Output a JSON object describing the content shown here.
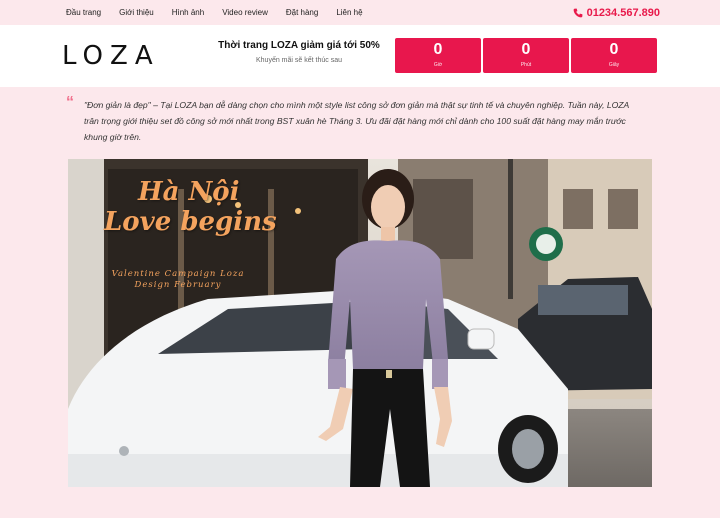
{
  "nav": {
    "items": [
      {
        "label": "Đầu trang"
      },
      {
        "label": "Giới thiệu"
      },
      {
        "label": "Hình ảnh"
      },
      {
        "label": "Video review"
      },
      {
        "label": "Đặt hàng"
      },
      {
        "label": "Liên hệ"
      }
    ],
    "phone": "01234.567.890"
  },
  "header": {
    "logo": "LOZA",
    "promo_title": "Thời trang LOZA giảm giá tới 50%",
    "promo_sub": "Khuyến mãi sẽ kết thúc sau",
    "countdown": [
      {
        "value": "0",
        "unit": "Giờ"
      },
      {
        "value": "0",
        "unit": "Phút"
      },
      {
        "value": "0",
        "unit": "Giây"
      }
    ]
  },
  "intro": {
    "text": "\"Đơn giản là đẹp\" – Tại LOZA bạn dễ dàng chọn cho mình một style list công sở đơn giản mà thật sự tinh tế và chuyên nghiệp. Tuần này, LOZA trân trọng giới thiệu set đồ công sở mới nhất trong BST xuân hè Tháng 3. Ưu đãi đặt hàng mới chỉ dành cho 100 suất đặt hàng may mắn trước khung giờ trên."
  },
  "hero": {
    "title_line1": "Hà Nội",
    "title_line2": "Love begins",
    "sub_line1": "Valentine Campaign Loza",
    "sub_line2": "Design February"
  },
  "colors": {
    "accent": "#e8174d",
    "background": "#fce8ec",
    "quote_mark": "#f06d8a"
  }
}
